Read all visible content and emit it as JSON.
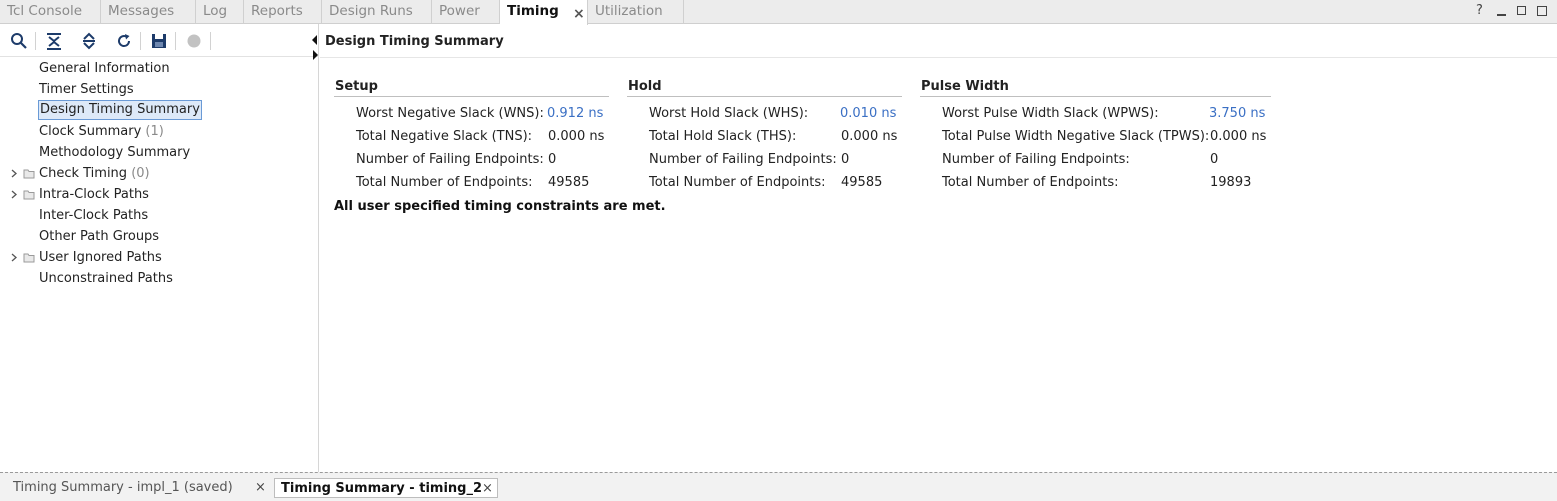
{
  "tabs": [
    {
      "label": "Tcl Console"
    },
    {
      "label": "Messages"
    },
    {
      "label": "Log"
    },
    {
      "label": "Reports"
    },
    {
      "label": "Design Runs"
    },
    {
      "label": "Power"
    },
    {
      "label": "Timing",
      "active": true,
      "close": "×"
    },
    {
      "label": "Utilization"
    }
  ],
  "window_controls": {
    "help": "?"
  },
  "icons": [
    "search-icon",
    "collapse-all-icon",
    "expand-all-icon",
    "refresh-icon",
    "save-icon",
    "stop-icon"
  ],
  "tree": {
    "general_information": "General Information",
    "timer_settings": "Timer Settings",
    "design_timing_summary": "Design Timing Summary",
    "clock_summary": "Clock Summary",
    "clock_summary_count": "(1)",
    "methodology_summary": "Methodology Summary",
    "check_timing": "Check Timing",
    "check_timing_count": "(0)",
    "intra_clock_paths": "Intra-Clock Paths",
    "inter_clock_paths": "Inter-Clock Paths",
    "other_path_groups": "Other Path Groups",
    "user_ignored_paths": "User Ignored Paths",
    "unconstrained_paths": "Unconstrained Paths"
  },
  "main": {
    "title": "Design Timing Summary",
    "setup": {
      "heading": "Setup",
      "rows": [
        {
          "label": "Worst Negative Slack (WNS):",
          "value": "0.912 ns"
        },
        {
          "label": "Total Negative Slack (TNS):",
          "value": "0.000 ns"
        },
        {
          "label": "Number of Failing Endpoints:",
          "value": "0"
        },
        {
          "label": "Total Number of Endpoints:",
          "value": "49585"
        }
      ]
    },
    "hold": {
      "heading": "Hold",
      "rows": [
        {
          "label": "Worst Hold Slack (WHS):",
          "value": "0.010 ns"
        },
        {
          "label": "Total Hold Slack (THS):",
          "value": "0.000 ns"
        },
        {
          "label": "Number of Failing Endpoints:",
          "value": "0"
        },
        {
          "label": "Total Number of Endpoints:",
          "value": "49585"
        }
      ]
    },
    "pulse_width": {
      "heading": "Pulse Width",
      "rows": [
        {
          "label": "Worst Pulse Width Slack (WPWS):",
          "value": "3.750 ns"
        },
        {
          "label": "Total Pulse Width Negative Slack (TPWS):",
          "value": "0.000 ns"
        },
        {
          "label": "Number of Failing Endpoints:",
          "value": "0"
        },
        {
          "label": "Total Number of Endpoints:",
          "value": "19893"
        }
      ]
    },
    "status_message": "All user specified timing constraints are met."
  },
  "bottom_tabs": [
    {
      "label": "Timing Summary - impl_1 (saved)",
      "close": "×"
    },
    {
      "label": "Timing Summary - timing_2",
      "close": "×",
      "active": true
    }
  ],
  "colors": {
    "link": "#3a6fc4",
    "selection": "#dde9f8",
    "tab_bar": "#ececec"
  }
}
